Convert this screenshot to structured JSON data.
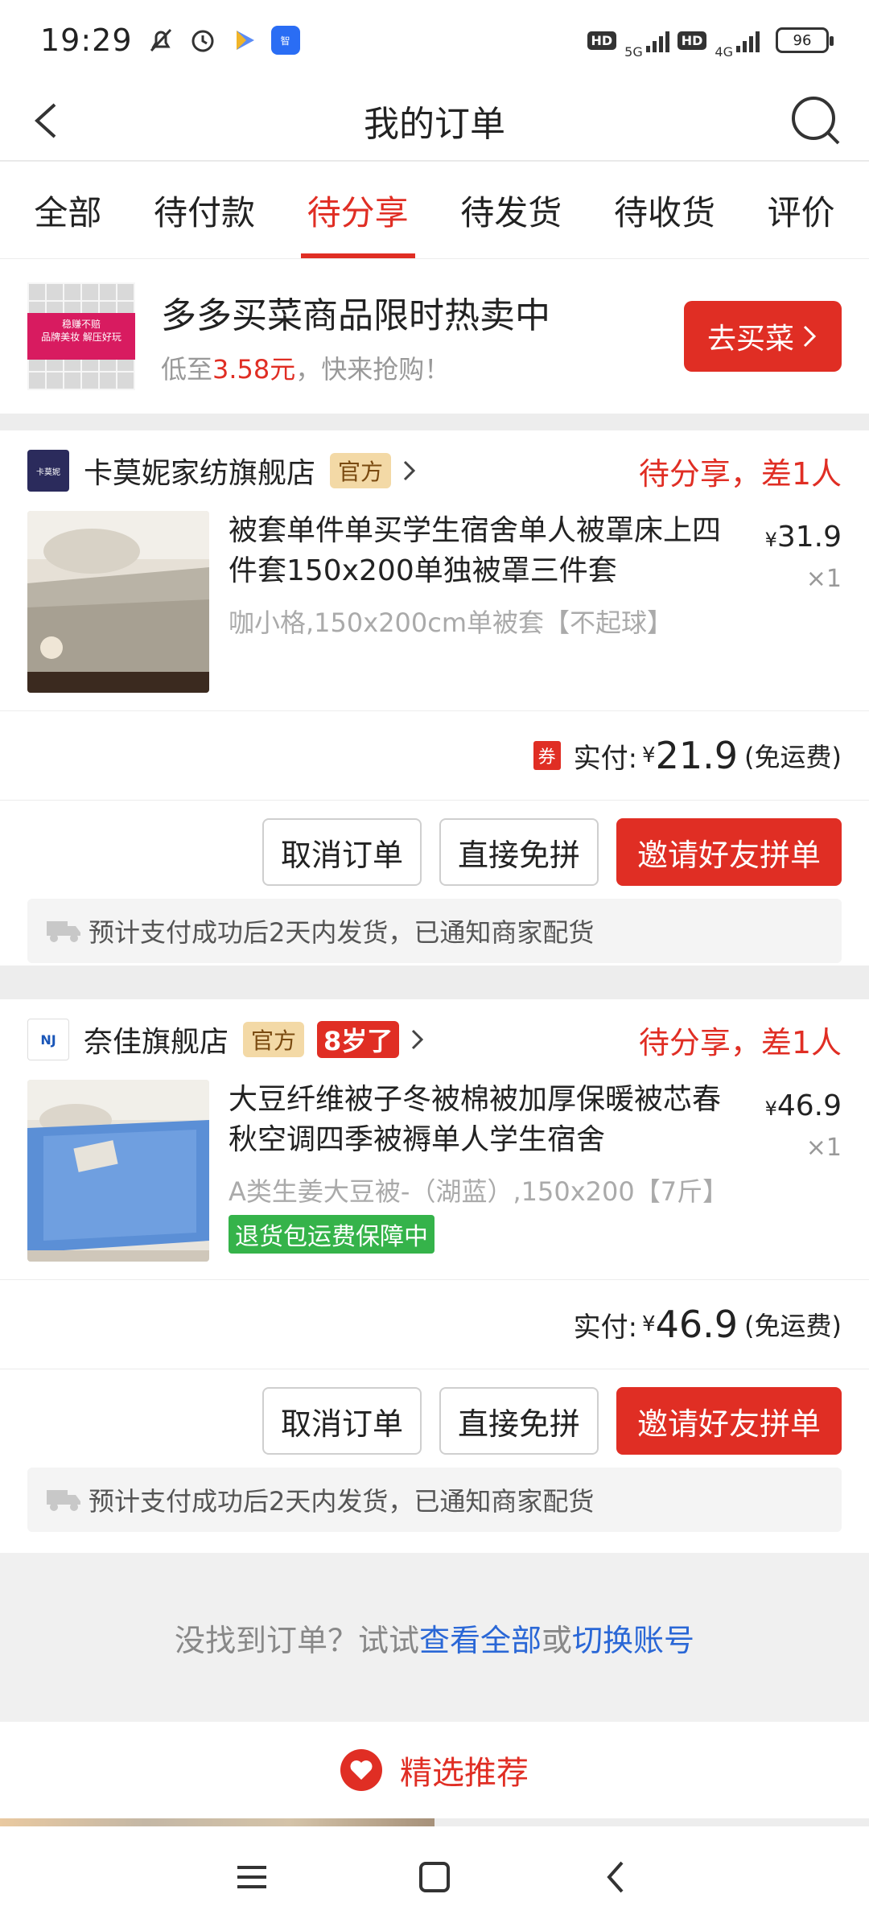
{
  "status_bar": {
    "time": "19:29",
    "hd1": "HD",
    "net1": "5G",
    "hd2": "HD",
    "net2": "4G",
    "battery": "96"
  },
  "header": {
    "title": "我的订单"
  },
  "tabs": [
    {
      "label": "全部"
    },
    {
      "label": "待付款"
    },
    {
      "label": "待分享"
    },
    {
      "label": "待发货"
    },
    {
      "label": "待收货"
    },
    {
      "label": "评价"
    }
  ],
  "promo": {
    "title": "多多买菜商品限时热卖中",
    "sub_prefix": "低至",
    "sub_price": "3.58元",
    "sub_suffix": "，快来抢购！",
    "button": "去买菜",
    "image_text_1": "稳赚不赔",
    "image_text_2": "品牌美妆 解压好玩"
  },
  "orders": [
    {
      "shop_name": "卡莫妮家纺旗舰店",
      "shop_logo_text": "卡莫妮",
      "official_badge": "官方",
      "status": "待分享，差1人",
      "title": "被套单件单买学生宿舍单人被罩床上四件套150x200单独被罩三件套",
      "spec": "咖小格,150x200cm单被套【不起球】",
      "price": "31.9",
      "qty": "×1",
      "coupon": "券",
      "pay_label": "实付:",
      "pay_amount": "21.9",
      "pay_note": "(免运费)",
      "btn_cancel": "取消订单",
      "btn_direct": "直接免拼",
      "btn_invite": "邀请好友拼单",
      "ship_note": "预计支付成功后2天内发货，已通知商家配货"
    },
    {
      "shop_name": "奈佳旗舰店",
      "shop_logo_text": "NJ",
      "official_badge": "官方",
      "age_badge": "8岁了",
      "status": "待分享，差1人",
      "title": "大豆纤维被子冬被棉被加厚保暖被芯春秋空调四季被褥单人学生宿舍",
      "spec": "A类生姜大豆被-（湖蓝）,150x200【7斤】",
      "tag": "退货包运费保障中",
      "price": "46.9",
      "qty": "×1",
      "pay_label": "实付:",
      "pay_amount": "46.9",
      "pay_note": "(免运费)",
      "btn_cancel": "取消订单",
      "btn_direct": "直接免拼",
      "btn_invite": "邀请好友拼单",
      "ship_note": "预计支付成功后2天内发货，已通知商家配货"
    }
  ],
  "currency": "¥",
  "tip": {
    "prefix": "没找到订单？试试",
    "link1": "查看全部",
    "mid": "或",
    "link2": "切换账号"
  },
  "recommend": {
    "label": "精选推荐"
  },
  "colors": {
    "accent": "#e02e24",
    "link": "#2a67d6",
    "success": "#35b34a"
  }
}
